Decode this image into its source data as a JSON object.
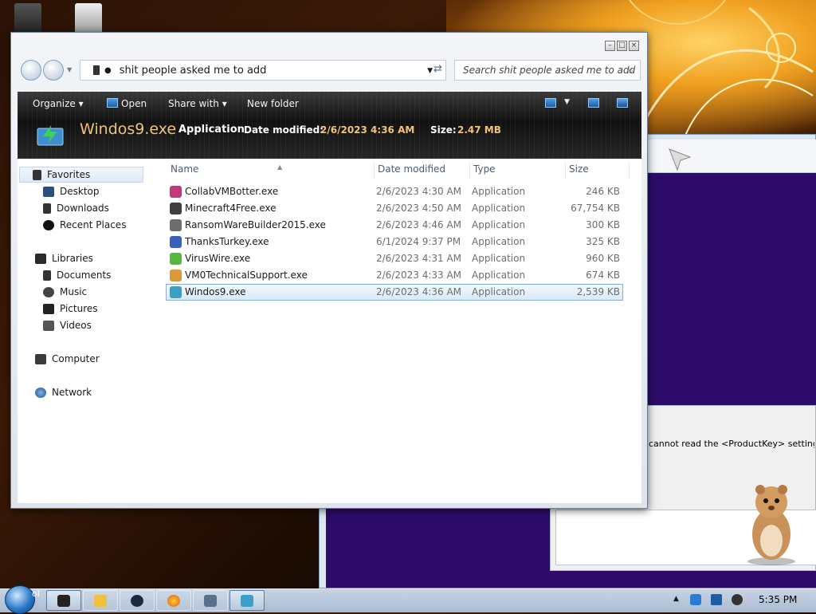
{
  "window": {
    "caption_buttons": [
      "minimize",
      "maximize",
      "close"
    ]
  },
  "navigation": {
    "address_path": "shit people asked me to add",
    "search_placeholder": "Search shit people asked me to add"
  },
  "toolbar": {
    "organize": "Organize",
    "open": "Open",
    "share_with": "Share with",
    "new_folder": "New folder"
  },
  "details": {
    "file_name": "Windos9.exe",
    "file_type": "Application",
    "date_modified_label": "Date modified:",
    "date_modified_value": "2/6/2023 4:36 AM",
    "size_label": "Size:",
    "size_value": "2.47 MB"
  },
  "nav_pane": {
    "favorites": "Favorites",
    "desktop": "Desktop",
    "downloads": "Downloads",
    "recent_places": "Recent Places",
    "libraries": "Libraries",
    "documents": "Documents",
    "music": "Music",
    "pictures": "Pictures",
    "videos": "Videos",
    "computer": "Computer",
    "network": "Network"
  },
  "columns": {
    "name": "Name",
    "date_modified": "Date modified",
    "type": "Type",
    "size": "Size"
  },
  "files": [
    {
      "name": "CollabVMBotter.exe",
      "date": "2/6/2023 4:30 AM",
      "type": "Application",
      "size": "246 KB",
      "color": "#c2387a"
    },
    {
      "name": "Minecraft4Free.exe",
      "date": "2/6/2023 4:50 AM",
      "type": "Application",
      "size": "67,754 KB",
      "color": "#3f3f3f"
    },
    {
      "name": "RansomWareBuilder2015.exe",
      "date": "2/6/2023 4:46 AM",
      "type": "Application",
      "size": "300 KB",
      "color": "#6d6d6d"
    },
    {
      "name": "ThanksTurkey.exe",
      "date": "6/1/2024 9:37 PM",
      "type": "Application",
      "size": "325 KB",
      "color": "#3a5fbf"
    },
    {
      "name": "VirusWire.exe",
      "date": "2/6/2023 4:31 AM",
      "type": "Application",
      "size": "960 KB",
      "color": "#56b83c"
    },
    {
      "name": "VM0TechnicalSupport.exe",
      "date": "2/6/2023 4:33 AM",
      "type": "Application",
      "size": "674 KB",
      "color": "#d99a3a"
    },
    {
      "name": "Windos9.exe",
      "date": "2/6/2023 4:36 AM",
      "type": "Application",
      "size": "2,539 KB",
      "color": "#3aa0c8"
    }
  ],
  "background_dialog": {
    "message": "cannot read the <ProductKey> setting f"
  },
  "taskbar": {
    "start_label": "ol",
    "clock": "5:35 PM"
  }
}
